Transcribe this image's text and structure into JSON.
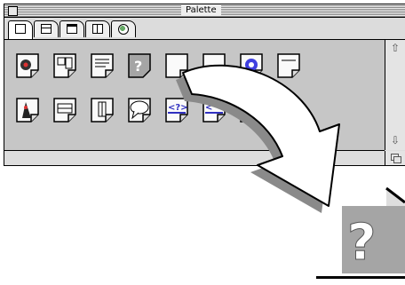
{
  "window": {
    "title": "Palette"
  },
  "tabs": [
    {
      "icon": "applet-icon",
      "active": true
    },
    {
      "icon": "panel-icon",
      "active": false
    },
    {
      "icon": "window-icon",
      "active": false
    },
    {
      "icon": "frame-icon",
      "active": false
    },
    {
      "icon": "globe-icon",
      "active": false
    }
  ],
  "palette_items_row1": [
    {
      "icon": "duke-jar-icon"
    },
    {
      "icon": "layout-doc-icon"
    },
    {
      "icon": "textarea-doc-icon"
    },
    {
      "icon": "help-doc-icon"
    },
    {
      "icon": "doc-icon"
    },
    {
      "icon": "doc-icon"
    },
    {
      "icon": "bug-doc-icon"
    },
    {
      "icon": "blank-doc-icon"
    }
  ],
  "palette_items_row2": [
    {
      "icon": "duke-doc-icon"
    },
    {
      "icon": "horizontal-split-icon"
    },
    {
      "icon": "vertical-split-icon"
    },
    {
      "icon": "speech-bubble-icon"
    },
    {
      "icon": "tag-doc-icon"
    },
    {
      "icon": "tag-doc-icon"
    },
    {
      "icon": "doc-icon"
    }
  ],
  "zoom": {
    "glyph": "?"
  },
  "colors": {
    "arrow_fill": "#ffffff",
    "arrow_shadow": "#8a8a8a",
    "grid_bg": "#c6c6c6",
    "highlight_icon": "#a5a5a5"
  }
}
